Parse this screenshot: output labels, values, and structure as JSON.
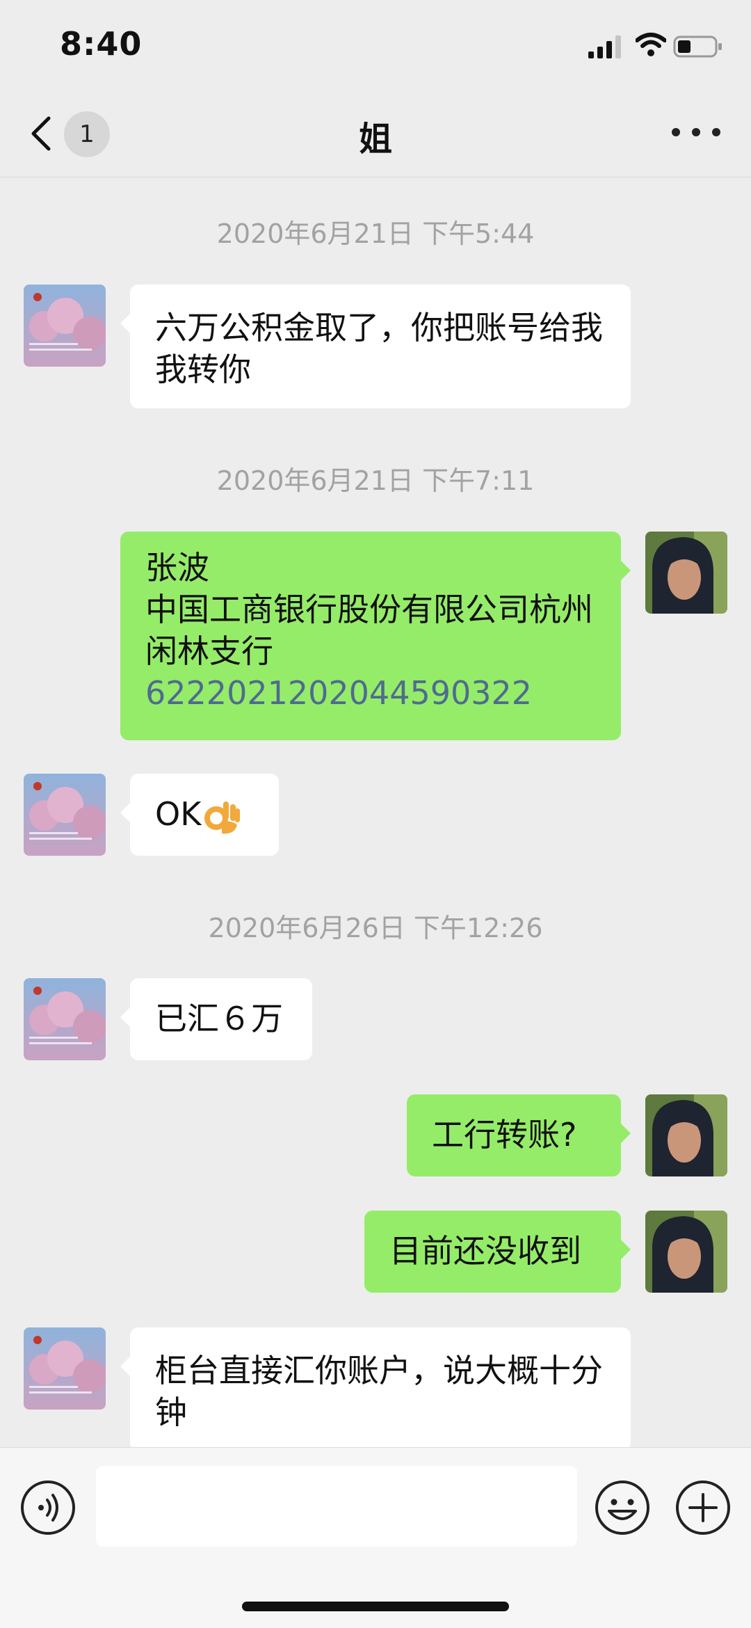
{
  "status_bar": {
    "time": "8:40"
  },
  "nav": {
    "back_badge": "1",
    "title": "姐"
  },
  "messages": [
    {
      "timestamp": "2020年6月21日 下午5:44"
    },
    {
      "text": "六万公积金取了，你把账号给我我转你"
    },
    {
      "timestamp": "2020年6月21日 下午7:11"
    },
    {
      "name": "张波",
      "bank": "中国工商银行股份有限公司杭州闲林支行",
      "account": "6222021202044590322"
    },
    {
      "text": "OK"
    },
    {
      "timestamp": "2020年6月26日 下午12:26"
    },
    {
      "text": "已汇６万"
    },
    {
      "text": "工行转账?"
    },
    {
      "text": "目前还没收到"
    },
    {
      "text": "柜台直接汇你账户，说大概十分钟"
    }
  ],
  "colors": {
    "outgoing_bubble": "#95ec69",
    "incoming_bubble": "#ffffff",
    "background": "#ededed"
  },
  "icons": [
    "back-chevron-icon",
    "more-icon",
    "voice-icon",
    "emoji-icon",
    "plus-icon",
    "ok-hand-emoji"
  ]
}
